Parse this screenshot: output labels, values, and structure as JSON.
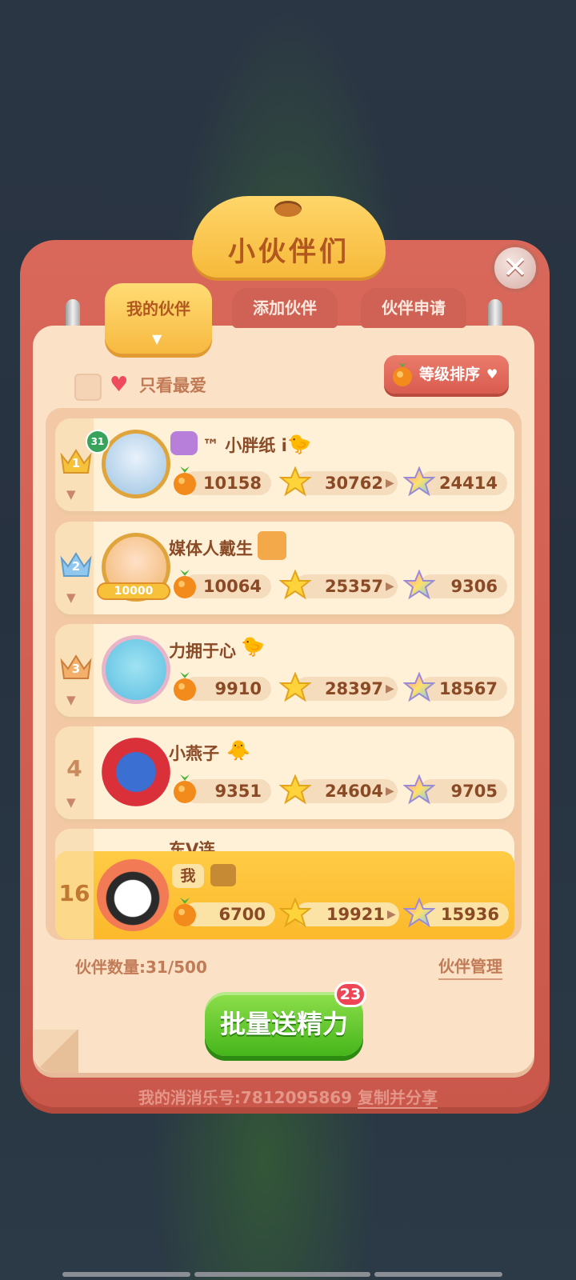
{
  "title": "小伙伴们",
  "tabs": [
    {
      "label": "我的伙伴",
      "active": true
    },
    {
      "label": "添加伙伴",
      "active": false
    },
    {
      "label": "伙伴申请",
      "active": false
    }
  ],
  "filter": {
    "favorites_label": "只看最爱"
  },
  "sort": {
    "label": "等级排序"
  },
  "friends": [
    {
      "rank": "1",
      "level": "31",
      "name": "™ 小胖纸 i",
      "stat1": "10158",
      "stat2": "30762",
      "stat3": "24414",
      "rank_color": "#f6c23a"
    },
    {
      "rank": "2",
      "name": "媒体人戴生",
      "avatar_badge": "10000",
      "stat1": "10064",
      "stat2": "25357",
      "stat3": "9306",
      "rank_color": "#8fc7ee"
    },
    {
      "rank": "3",
      "name": "力拥于心",
      "stat1": "9910",
      "stat2": "28397",
      "stat3": "18567",
      "rank_color": "#f2b06a"
    },
    {
      "rank": "4",
      "name": "小燕子",
      "stat1": "9351",
      "stat2": "24604",
      "stat3": "9705"
    }
  ],
  "partial_friend": {
    "name": "东V连"
  },
  "me": {
    "rank": "16",
    "label": "我",
    "stat1": "6700",
    "stat2": "19921",
    "stat3": "15936"
  },
  "count_text": "伙伴数量:31/500",
  "manage_label": "伙伴管理",
  "send_button": {
    "label": "批量送精力",
    "badge": "23"
  },
  "footer": {
    "id_text": "我的消消乐号:7812095869",
    "share_label": "复制并分享"
  },
  "icons": {
    "close": "close-icon",
    "fruit": "energy-fruit-icon",
    "star": "star-icon",
    "rainbow_star": "rainbow-star-icon",
    "heart": "heart-icon"
  }
}
